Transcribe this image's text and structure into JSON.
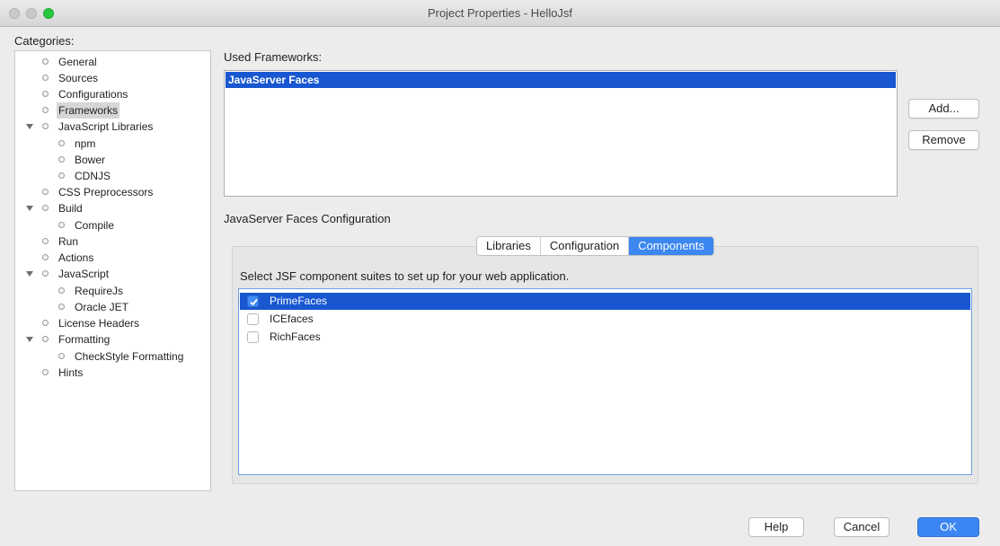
{
  "window": {
    "title": "Project Properties - HelloJsf"
  },
  "categories": {
    "label": "Categories:",
    "items": [
      {
        "label": "General"
      },
      {
        "label": "Sources"
      },
      {
        "label": "Configurations"
      },
      {
        "label": "Frameworks",
        "selected": true
      },
      {
        "label": "JavaScript Libraries",
        "expanded": true
      },
      {
        "label": "npm"
      },
      {
        "label": "Bower"
      },
      {
        "label": "CDNJS"
      },
      {
        "label": "CSS Preprocessors"
      },
      {
        "label": "Build",
        "expanded": true
      },
      {
        "label": "Compile"
      },
      {
        "label": "Run"
      },
      {
        "label": "Actions"
      },
      {
        "label": "JavaScript",
        "expanded": true
      },
      {
        "label": "RequireJs"
      },
      {
        "label": "Oracle JET"
      },
      {
        "label": "License Headers"
      },
      {
        "label": "Formatting",
        "expanded": true
      },
      {
        "label": "CheckStyle Formatting"
      },
      {
        "label": "Hints"
      }
    ]
  },
  "frameworks": {
    "label": "Used Frameworks:",
    "items": [
      "JavaServer Faces"
    ],
    "add_label": "Add...",
    "remove_label": "Remove"
  },
  "jsf": {
    "label": "JavaServer Faces Configuration",
    "tabs": [
      "Libraries",
      "Configuration",
      "Components"
    ],
    "active_tab": "Components",
    "components_text": "Select JSF component suites to set up for your web application.",
    "components": [
      {
        "label": "PrimeFaces",
        "checked": true
      },
      {
        "label": "ICEfaces",
        "checked": false
      },
      {
        "label": "RichFaces",
        "checked": false
      }
    ]
  },
  "footer": {
    "help_label": "Help",
    "cancel_label": "Cancel",
    "ok_label": "OK"
  },
  "colors": {
    "selection": "#1957d1",
    "accent": "#3b86f2"
  }
}
